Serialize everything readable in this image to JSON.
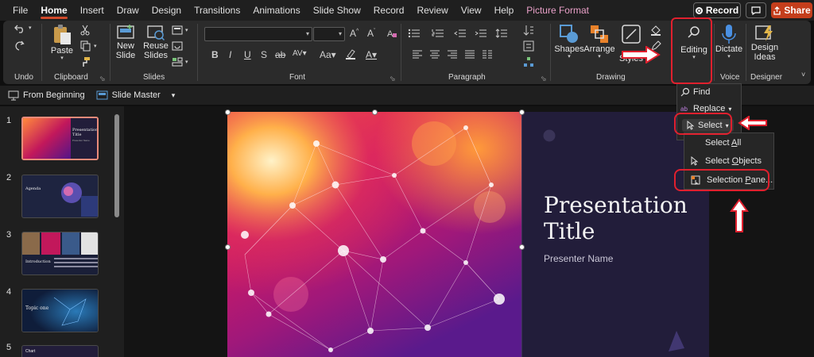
{
  "menubar": {
    "tabs": [
      "File",
      "Home",
      "Insert",
      "Draw",
      "Design",
      "Transitions",
      "Animations",
      "Slide Show",
      "Record",
      "Review",
      "View",
      "Help",
      "Picture Format"
    ],
    "record_label": "Record",
    "share_label": "Share"
  },
  "ribbon": {
    "undo_label": "Undo",
    "clipboard": {
      "paste_label": "Paste",
      "group_label": "Clipboard"
    },
    "slides": {
      "new_slide_label": "New Slide",
      "reuse_slides_label": "Reuse Slides",
      "group_label": "Slides"
    },
    "font": {
      "group_label": "Font",
      "font_name": "",
      "font_size": ""
    },
    "paragraph": {
      "group_label": "Paragraph"
    },
    "drawing": {
      "shapes_label": "Shapes",
      "arrange_label": "Arrange",
      "quick_styles_label": "Styles",
      "group_label": "Drawing"
    },
    "editing": {
      "label": "Editing"
    },
    "voice": {
      "dictate_label": "Dictate",
      "group_label": "Voice"
    },
    "designer": {
      "design_ideas_label": "Design Ideas",
      "group_label": "Designer"
    }
  },
  "qat": {
    "from_beginning_label": "From Beginning",
    "slide_master_label": "Slide Master"
  },
  "thumbnails": [
    {
      "number": "1",
      "selected": true,
      "title": "Presentation Title",
      "sub": "Presenter Name"
    },
    {
      "number": "2",
      "selected": false,
      "title": "Agenda"
    },
    {
      "number": "3",
      "selected": false,
      "title": "Introduction"
    },
    {
      "number": "4",
      "selected": false,
      "title": "Topic one"
    },
    {
      "number": "5",
      "selected": false,
      "title": "Chart"
    }
  ],
  "slide": {
    "title_line1": "Presentation",
    "title_line2": "Title",
    "presenter": "Presenter Name"
  },
  "editing_menu": {
    "find_label": "Find",
    "replace_label": "Replace",
    "select_label": "Select"
  },
  "select_menu": {
    "items": [
      {
        "pre": "Select ",
        "u": "A",
        "post": "ll"
      },
      {
        "pre": "Select ",
        "u": "O",
        "post": "bjects"
      },
      {
        "pre": "Selection ",
        "u": "P",
        "post": "ane..."
      }
    ]
  },
  "colors": {
    "accent": "#c43e1c",
    "highlight": "#e0202e",
    "ribbon_bg": "#2b2b2b",
    "slide_panel": "#221d3a"
  }
}
